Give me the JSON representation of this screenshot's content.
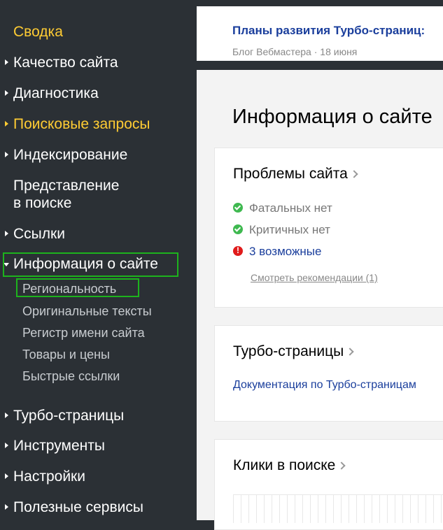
{
  "sidebar": {
    "items": [
      {
        "label": "Сводка"
      },
      {
        "label": "Качество сайта"
      },
      {
        "label": "Диагностика"
      },
      {
        "label": "Поисковые запросы"
      },
      {
        "label": "Индексирование"
      },
      {
        "label": "Представление"
      },
      {
        "label": "в поиске"
      },
      {
        "label": "Ссылки"
      },
      {
        "label": "Информация о сайте"
      },
      {
        "label": "Турбо-страницы"
      },
      {
        "label": "Инструменты"
      },
      {
        "label": "Настройки"
      },
      {
        "label": "Полезные сервисы"
      }
    ],
    "subitems": [
      {
        "label": "Региональность"
      },
      {
        "label": "Оригинальные тексты"
      },
      {
        "label": "Регистр имени сайта"
      },
      {
        "label": "Товары и цены"
      },
      {
        "label": "Быстрые ссылки"
      }
    ]
  },
  "news": {
    "title": "Планы развития Турбо-страниц:",
    "meta": "Блог Вебмастера · 18 июня"
  },
  "main": {
    "title": "Информация о сайте",
    "problems": {
      "title": "Проблемы сайта",
      "fatal": "Фатальных нет",
      "critical": "Критичных нет",
      "possible": "3 возможные",
      "recommendations": "Смотреть рекомендации (1)"
    },
    "turbo": {
      "title": "Турбо-страницы",
      "doc_link": "Документация по Турбо-страницам"
    },
    "clicks": {
      "title": "Клики в поиске"
    }
  },
  "colors": {
    "sidebar_bg": "#2b3035",
    "accent": "#ffcc33",
    "link": "#1a3e9c",
    "highlight": "#1db31d",
    "ok": "#3fb950",
    "error": "#e01b1b"
  }
}
